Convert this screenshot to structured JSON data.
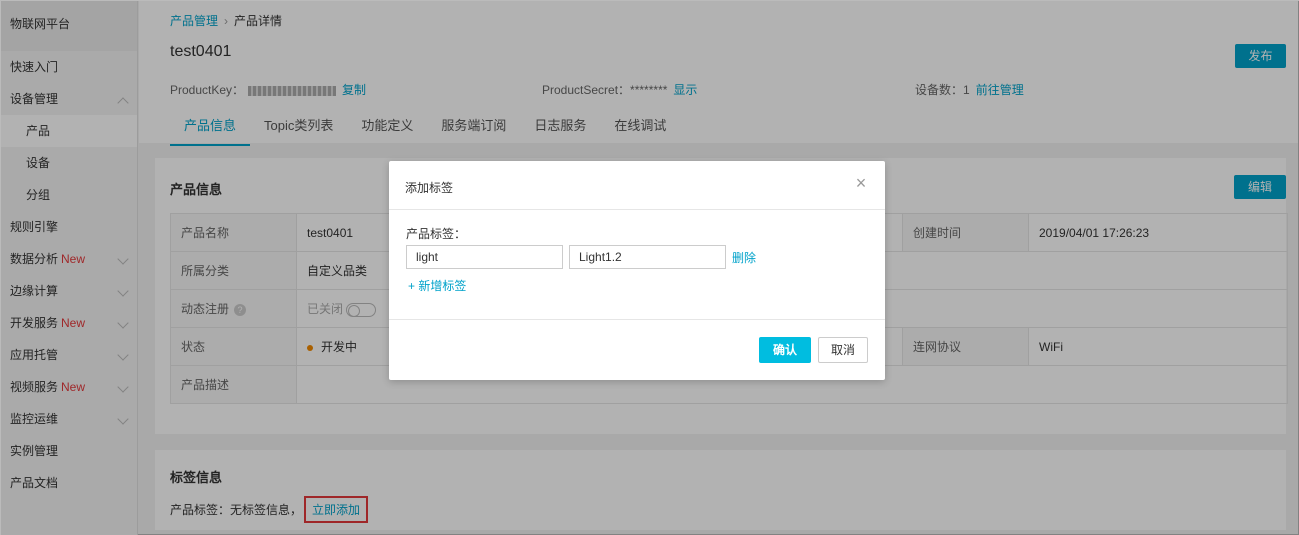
{
  "sidebar": {
    "items": [
      {
        "label": "物联网平台",
        "badge": ""
      },
      {
        "label": "快速入门",
        "badge": ""
      },
      {
        "label": "设备管理",
        "badge": ""
      },
      {
        "label": "产品",
        "badge": ""
      },
      {
        "label": "设备",
        "badge": ""
      },
      {
        "label": "分组",
        "badge": ""
      },
      {
        "label": "规则引擎",
        "badge": ""
      },
      {
        "label": "数据分析",
        "badge": "New"
      },
      {
        "label": "边缘计算",
        "badge": ""
      },
      {
        "label": "开发服务",
        "badge": "New"
      },
      {
        "label": "应用托管",
        "badge": ""
      },
      {
        "label": "视频服务",
        "badge": "New"
      },
      {
        "label": "监控运维",
        "badge": ""
      },
      {
        "label": "实例管理",
        "badge": ""
      },
      {
        "label": "产品文档",
        "badge": ""
      }
    ]
  },
  "header": {
    "breadcrumb": {
      "parent": "产品管理",
      "current": "产品详情"
    },
    "title": "test0401",
    "publish_label": "发布",
    "product_key_label": "ProductKey：",
    "copy_label": "复制",
    "product_secret_label": "ProductSecret：",
    "product_secret_value": "********",
    "show_label": "显示",
    "device_count_label": "设备数：",
    "device_count_value": "1",
    "manage_label": "前往管理",
    "tabs": [
      "产品信息",
      "Topic类列表",
      "功能定义",
      "服务端订阅",
      "日志服务",
      "在线调试"
    ]
  },
  "info": {
    "title": "产品信息",
    "edit_label": "编辑",
    "product_name_label": "产品名称",
    "product_name_value": "test0401",
    "created_label": "创建时间",
    "created_value": "2019/04/01 17:26:23",
    "category_label": "所属分类",
    "category_value": "自定义品类",
    "dynamic_label": "动态注册",
    "dynamic_value": "已关闭",
    "status_label": "状态",
    "status_value": "开发中",
    "protocol_label": "连网协议",
    "protocol_value": "WiFi",
    "desc_label": "产品描述"
  },
  "tags": {
    "title": "标签信息",
    "line_label": "产品标签：无标签信息，",
    "add_now_label": "立即添加"
  },
  "modal": {
    "title": "添加标签",
    "field_label": "产品标签：",
    "key_value": "light",
    "value_value": "Light1.2",
    "delete_label": "删除",
    "add_label": "+ 新增标签",
    "ok_label": "确认",
    "cancel_label": "取消"
  },
  "colors": {
    "accent": "#00a2ca",
    "new_badge": "#e4393c",
    "status_dot": "#f28a00"
  }
}
